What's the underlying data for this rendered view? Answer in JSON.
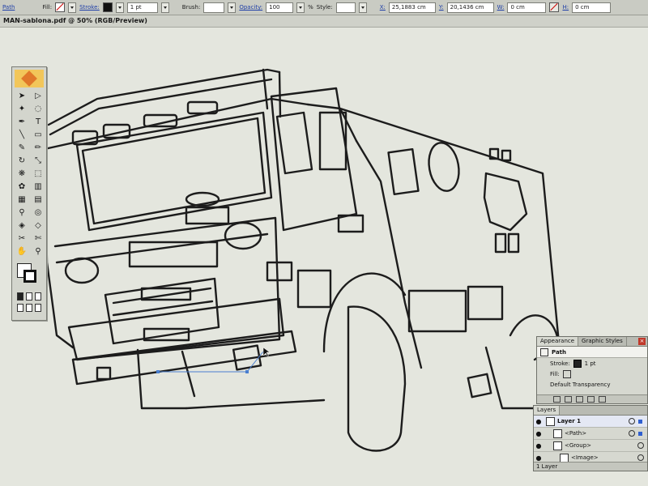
{
  "control_bar": {
    "selection_label": "Path",
    "fill_label": "Fill:",
    "stroke_label": "Stroke:",
    "stroke_weight": "1 pt",
    "brush_label": "Brush:",
    "opacity_label": "Opacity:",
    "opacity_value": "100",
    "opacity_unit": "%",
    "style_label": "Style:",
    "x_label": "X:",
    "x_value": "25,1883 cm",
    "y_label": "Y:",
    "y_value": "20,1436 cm",
    "w_label": "W:",
    "w_value": "0 cm",
    "h_label": "H:",
    "h_value": "0 cm"
  },
  "document": {
    "title": "MAN-sablona.pdf @ 50% (RGB/Preview)"
  },
  "tools": {
    "items": [
      {
        "name": "selection-tool-icon",
        "glyph": "➤"
      },
      {
        "name": "direct-selection-tool-icon",
        "glyph": "▷"
      },
      {
        "name": "magic-wand-tool-icon",
        "glyph": "✦"
      },
      {
        "name": "lasso-tool-icon",
        "glyph": "◌"
      },
      {
        "name": "pen-tool-icon",
        "glyph": "✒"
      },
      {
        "name": "type-tool-icon",
        "glyph": "T"
      },
      {
        "name": "line-tool-icon",
        "glyph": "╲"
      },
      {
        "name": "rectangle-tool-icon",
        "glyph": "▭"
      },
      {
        "name": "paintbrush-tool-icon",
        "glyph": "✎"
      },
      {
        "name": "pencil-tool-icon",
        "glyph": "✏"
      },
      {
        "name": "rotate-tool-icon",
        "glyph": "↻"
      },
      {
        "name": "scale-tool-icon",
        "glyph": "⤡"
      },
      {
        "name": "warp-tool-icon",
        "glyph": "❋"
      },
      {
        "name": "free-transform-tool-icon",
        "glyph": "⬚"
      },
      {
        "name": "symbol-sprayer-tool-icon",
        "glyph": "✿"
      },
      {
        "name": "column-graph-tool-icon",
        "glyph": "▥"
      },
      {
        "name": "mesh-tool-icon",
        "glyph": "▦"
      },
      {
        "name": "gradient-tool-icon",
        "glyph": "▤"
      },
      {
        "name": "eyedropper-tool-icon",
        "glyph": "⚲"
      },
      {
        "name": "blend-tool-icon",
        "glyph": "◎"
      },
      {
        "name": "live-paint-tool-icon",
        "glyph": "◈"
      },
      {
        "name": "live-paint-selection-tool-icon",
        "glyph": "◇"
      },
      {
        "name": "slice-tool-icon",
        "glyph": "✂"
      },
      {
        "name": "scissors-tool-icon",
        "glyph": "✄"
      },
      {
        "name": "hand-tool-icon",
        "glyph": "✋"
      },
      {
        "name": "zoom-tool-icon",
        "glyph": "⚲"
      }
    ]
  },
  "appearance_panel": {
    "tab_appearance": "Appearance",
    "tab_graphic_styles": "Graphic Styles",
    "object_type": "Path",
    "stroke_label": "Stroke:",
    "stroke_value": "1 pt",
    "fill_label": "Fill:",
    "transparency": "Default Transparency"
  },
  "layers_panel": {
    "tab": "Layers",
    "rows": [
      {
        "name": "Layer 1",
        "bold": true
      },
      {
        "name": "<Path>",
        "bold": false
      },
      {
        "name": "<Group>",
        "bold": false
      },
      {
        "name": "<Image>",
        "bold": false
      }
    ],
    "footer": "1 Layer"
  }
}
